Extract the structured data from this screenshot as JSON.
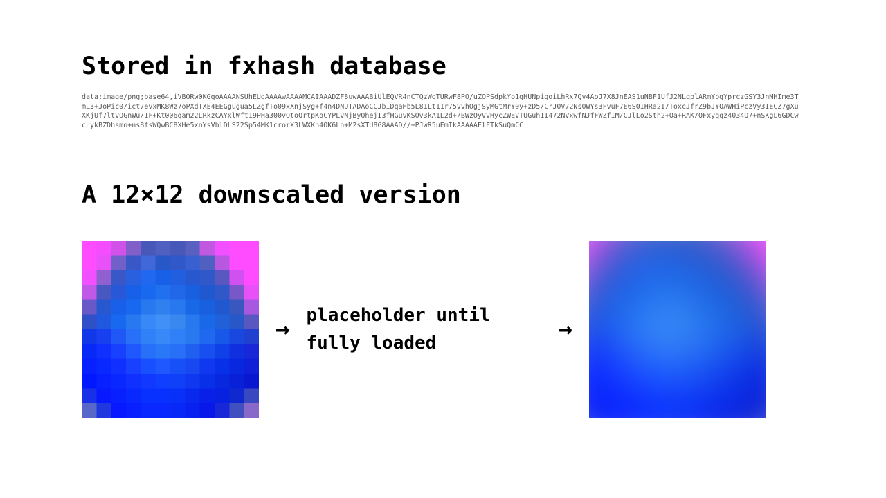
{
  "heading1": "Stored in fxhash database",
  "heading2": "A 12×12 downscaled version",
  "base64_text": "data:image/png;base64,iVBORw0KGgoAAAANSUhEUgAAAAwAAAAMCAIAAADZF8uwAAABiUlEQVR4nCTQzWoTURwF8PO/uZOPSdpkYo1gHUNpigoiLhRx7Qv4AoJ7X8JnEAS1uNBF1UfJ2NLqplARmYpgYprczGSY3JnMHIme3TmL3+JoPic0/ict7evxMK8Wz7oPXdTXE4EEGgugua5LZgfTo09xXnjSyg+f4n4DNUTADAoCCJbIDqaHb5L81Lt11r75VvhOgjSyMGtMrY0y+zD5/CrJ0V72Ns0WYs3FvuF7E6S0IHRa2I/ToxcJfrZ9bJYQAWHiPczVy3IECZ7gXuXKjUf7ltVOGnWu/1F+Kt006qam22LRkzCAYxlWft19PHa300vOtoQrtpKoCYPLvNjByQhejI3fHGuvKSOv3kA1L2d+/BWzOyVVHycZWEVTUGuh1I472NVxwfNJfFWZfIM/CJlLo2Sth2+Qa+RAK/QFxyqqz4034Q7+nSKgL6GDCwcLykBZDhsmo+ns8fsWQwBC8XHe5xnYsVhlDLS22Sp54MK1crorX3LWXKn4OK6Ln+M2sXTU8G8AAAD//+PJwR5uEmIkAAAAAElFTkSuQmCC",
  "mid_text": "placeholder until fully loaded",
  "arrow_glyph": "→",
  "thumb_pixels": {
    "width": 12,
    "height": 12,
    "rows": [
      [
        "#ff4cff",
        "#f44cff",
        "#d052e8",
        "#8060c8",
        "#4858b8",
        "#5060c0",
        "#4858b8",
        "#5860c0",
        "#c058e0",
        "#f050ff",
        "#ff4cff",
        "#ff4cff"
      ],
      [
        "#ff4cff",
        "#e850f8",
        "#7060c8",
        "#3858c8",
        "#4068d8",
        "#2858c8",
        "#3058c8",
        "#3860d0",
        "#5060c0",
        "#b858e0",
        "#ff4cff",
        "#ff4cff"
      ],
      [
        "#f050ff",
        "#9060d0",
        "#3858c8",
        "#2860e0",
        "#2068f0",
        "#1860e8",
        "#2060e0",
        "#2858d0",
        "#3058c8",
        "#5858c0",
        "#d050f0",
        "#ff4cff"
      ],
      [
        "#c058e8",
        "#4858c0",
        "#2858d8",
        "#1860e8",
        "#1868f0",
        "#2070f0",
        "#2068e8",
        "#1860e0",
        "#2058d0",
        "#3058c8",
        "#7858c8",
        "#e850f8"
      ],
      [
        "#6858c8",
        "#2858d0",
        "#1860e8",
        "#1868f0",
        "#2878f0",
        "#3080f0",
        "#2878f0",
        "#1868e8",
        "#1860e0",
        "#2058d0",
        "#3858c0",
        "#a858e0"
      ],
      [
        "#3050c8",
        "#2058e0",
        "#1868f0",
        "#2878f0",
        "#3888f8",
        "#4090f8",
        "#3888f0",
        "#2878f0",
        "#1868e8",
        "#2060d8",
        "#2858c8",
        "#5858c0"
      ],
      [
        "#1038e8",
        "#1840f0",
        "#2058f8",
        "#2870f8",
        "#3080f8",
        "#3888f8",
        "#3080f8",
        "#2878f0",
        "#2068f0",
        "#1858e8",
        "#1848e0",
        "#2040d0"
      ],
      [
        "#0828f8",
        "#1030ff",
        "#1840ff",
        "#2058ff",
        "#2870f8",
        "#2878f8",
        "#2870f8",
        "#2060f0",
        "#1850f0",
        "#1040e8",
        "#1030e0",
        "#1828d8"
      ],
      [
        "#0820ff",
        "#0828ff",
        "#1030ff",
        "#1840ff",
        "#1850ff",
        "#2058ff",
        "#1850f8",
        "#1848f0",
        "#1038f0",
        "#0830e8",
        "#0828e0",
        "#1020d8"
      ],
      [
        "#0018ff",
        "#0820ff",
        "#0828ff",
        "#1030ff",
        "#1038ff",
        "#1040ff",
        "#1040f8",
        "#1038f0",
        "#0830e8",
        "#0828e0",
        "#0820d8",
        "#0818d0"
      ],
      [
        "#1830e8",
        "#0818ff",
        "#0820ff",
        "#0828ff",
        "#0830ff",
        "#0830ff",
        "#0830f8",
        "#0828f0",
        "#0820e8",
        "#0820e0",
        "#1028d0",
        "#3848c0"
      ],
      [
        "#5868c8",
        "#2038e0",
        "#0818ff",
        "#0820ff",
        "#0828ff",
        "#0828ff",
        "#0828f8",
        "#0820f0",
        "#0818e8",
        "#1828d8",
        "#4050c0",
        "#8868c8"
      ]
    ]
  }
}
